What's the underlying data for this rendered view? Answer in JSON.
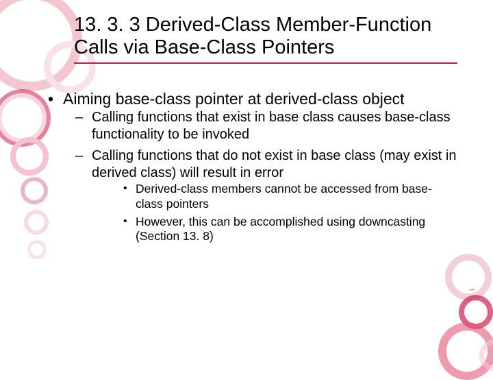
{
  "title": "13. 3. 3 Derived-Class Member-Function Calls via Base-Class Pointers",
  "bullets": {
    "lvl1": "Aiming base-class pointer at derived-class object",
    "lvl2a": "Calling functions that exist in base class causes base-class functionality to be invoked",
    "lvl2b": "Calling functions that do not exist in base class (may exist in derived class) will result in error",
    "lvl3a": "Derived-class members cannot be accessed from base-class pointers",
    "lvl3b": "However, this can be accomplished using downcasting (Section 13. 8)"
  },
  "page": "1"
}
